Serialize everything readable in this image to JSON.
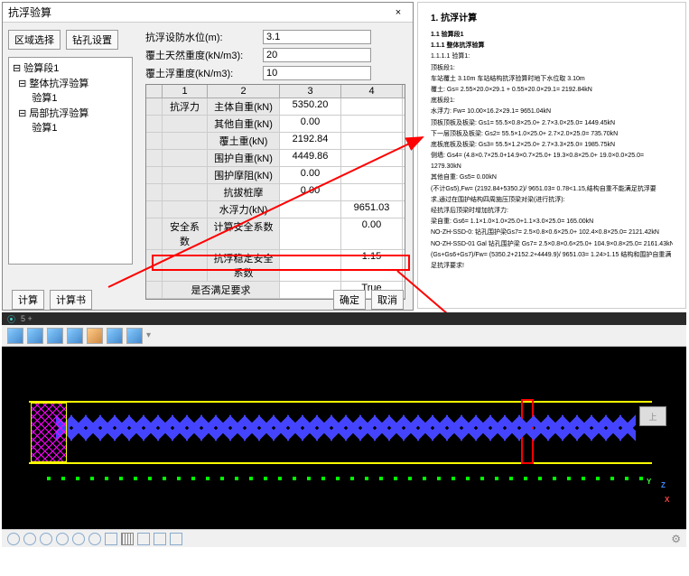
{
  "dialog": {
    "title": "抗浮验算",
    "close": "×",
    "tabs": {
      "region": "区域选择",
      "drill": "钻孔设置"
    },
    "tree": {
      "root": "⊟ 验算段1",
      "n1": "  ⊟ 整体抗浮验算",
      "n1a": "       验算1",
      "n2": "  ⊟ 局部抗浮验算",
      "n2a": "       验算1"
    },
    "params": {
      "level_label": "抗浮设防水位(m):",
      "level_val": "3.1",
      "natw_label": "覆土天然重度(kN/m3):",
      "natw_val": "20",
      "buoy_label": "覆土浮重度(kN/m3):",
      "buoy_val": "10"
    },
    "grid": {
      "head": [
        "",
        "1",
        "2",
        "3",
        "4"
      ],
      "group1": "抗浮力",
      "rows1": [
        {
          "l": "主体自重(kN)",
          "v3": "5350.20",
          "v4": ""
        },
        {
          "l": "其他自重(kN)",
          "v3": "0.00",
          "v4": ""
        },
        {
          "l": "覆土重(kN)",
          "v3": "2192.84",
          "v4": ""
        },
        {
          "l": "围护自重(kN)",
          "v3": "4449.86",
          "v4": ""
        },
        {
          "l": "围护摩阻(kN)",
          "v3": "0.00",
          "v4": ""
        },
        {
          "l": "抗拔桩摩",
          "v3": "0.00",
          "v4": ""
        }
      ],
      "buoy": {
        "l": "水浮力(kN)",
        "v4": "9651.03"
      },
      "group2": "安全系数",
      "rows2": [
        {
          "l": "计算安全系数",
          "v4": "0.00"
        },
        {
          "l": "抗浮稳定安全系数",
          "v4": "1.15"
        }
      ],
      "meet": {
        "l": "是否满足要求",
        "v4": "True"
      }
    },
    "foot": {
      "calc": "计算",
      "calcbook": "计算书",
      "ok": "确定",
      "cancel": "取消"
    }
  },
  "doc": {
    "h1": "1. 抗浮计算",
    "h2": "1.1 验算段1",
    "h3": "1.1.1 整体抗浮验算",
    "l1": "1.1.1.1 验算1:",
    "l2": "顶板段1:",
    "l3": "车站覆土 3.10m 车站结构抗浮验算时地下水位取 3.10m",
    "l4": "覆土: Gs= 2.55×20.0×29.1 + 0.55×20.0×29.1= 2192.84kN",
    "l5": "底板段1:",
    "l6": "水浮力: Fw= 10.00×16.2×29.1= 9651.04kN",
    "l7": "顶板顶板及板梁: Gs1= 55.5×0.8×25.0+ 2.7×3.0×25.0= 1449.45kN",
    "l8": "下一层顶板及板梁: Gs2= 55.5×1.0×25.0+ 2.7×2.0×25.0= 735.70kN",
    "l9": "底板底板及板梁: Gs3= 55.5×1.2×25.0+ 2.7×3.3×25.0= 1985.75kN",
    "l10": "侧墙: Gs4= (4.8×0.7×25.0+14.9×0.7×25.0+ 19.3×0.8×25.0+ 19.0×0.0×25.0=",
    "l10b": "1279.30kN",
    "l11": "其他自重: Gs5= 0.00kN",
    "l12": "(不计Gs5),Fw= (2192.84+5350.2)/ 9651.03= 0.78<1.15,结构自重不能满足抗浮要",
    "l13": "求,通过在围护结构四周施压顶梁对梁(进行抗浮):",
    "l14": "经抗浮后顶梁时增加抗浮力:",
    "l15": "梁自重: Gs6= 1.1×1.0×1.0×25.0+1.1×3.0×25.0= 165.00kN",
    "l16": "NO-ZH-SSD-0: 钻孔围护梁Gs7= 2.5×0.8×0.6×25.0+ 102.4×0.8×25.0= 2121.42kN",
    "l17": "NO-ZH-SSD-01 Gal 钻孔围护梁 Gs7= 2.5×0.8×0.6×25.0+ 104.9×0.8×25.0= 2161.43kN",
    "l18": "(Gs+Gs6+Gs7)/Fw= (5350.2+2152.2+4449.9)/ 9651.03= 1.24>1.15 结构和围护自重满",
    "l19": "足抗浮要求!"
  },
  "cad": {
    "topbar": "5  +",
    "orient": "上"
  }
}
